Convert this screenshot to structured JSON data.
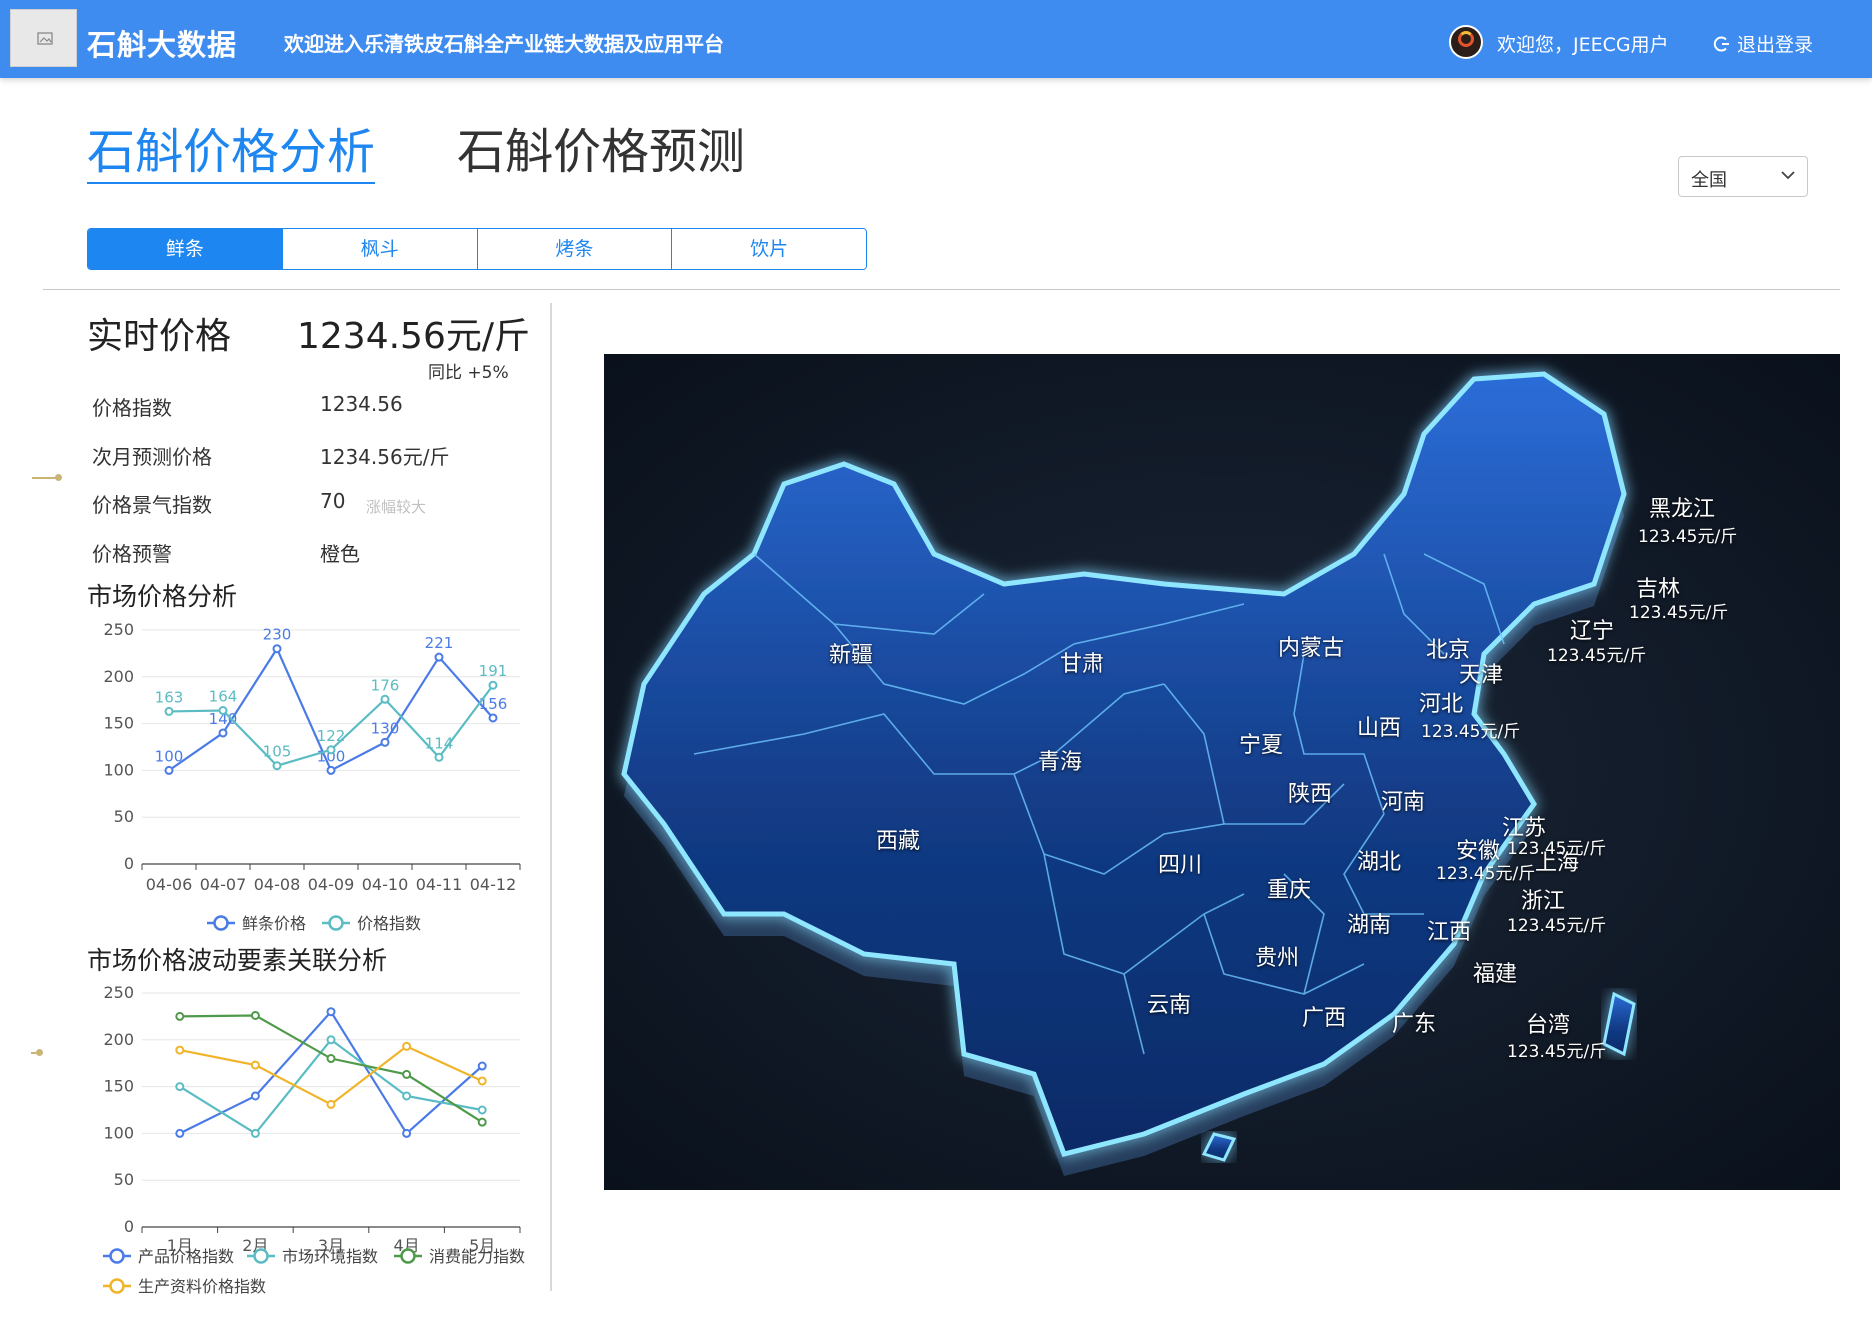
{
  "header": {
    "app_title": "石斛大数据",
    "banner": "欢迎进入乐清铁皮石斛全产业链大数据及应用平台",
    "greeting": "欢迎您，JEECG用户",
    "logout_label": "退出登录",
    "logo_icon": "image-placeholder-icon",
    "avatar_icon": "user-avatar-icon",
    "logout_icon": "logout-icon",
    "accent_color": "#3f8cf0"
  },
  "nav": {
    "tab_analysis": "石斛价格分析",
    "tab_forecast": "石斛价格预测",
    "active": "石斛价格分析"
  },
  "region_select": {
    "value": "全国",
    "icon": "chevron-down-icon"
  },
  "product_tabs": [
    "鲜条",
    "枫斗",
    "烤条",
    "饮片"
  ],
  "realtime": {
    "label": "实时价格",
    "value": "1234.56元/斤",
    "yoy": "同比 +5%"
  },
  "stats": [
    {
      "label": "价格指数",
      "value": "1234.56"
    },
    {
      "label": "次月预测价格",
      "value": "1234.56元/斤"
    },
    {
      "label": "价格景气指数",
      "value": "70",
      "tag": "涨幅较大"
    },
    {
      "label": "价格预警",
      "value": "橙色"
    }
  ],
  "sections": {
    "market": "市场价格分析",
    "factors": "市场价格波动要素关联分析"
  },
  "chart_data": [
    {
      "type": "line",
      "title": "市场价格分析",
      "categories": [
        "04-06",
        "04-07",
        "04-08",
        "04-09",
        "04-10",
        "04-11",
        "04-12"
      ],
      "ylim": [
        0,
        250
      ],
      "yticks": [
        0,
        50,
        100,
        150,
        200,
        250
      ],
      "grid": true,
      "legend": "bottom",
      "series": [
        {
          "name": "鲜条价格",
          "values": [
            100,
            140,
            230,
            100,
            130,
            221,
            156
          ],
          "color": "#4a7be6"
        },
        {
          "name": "价格指数",
          "values": [
            163,
            164,
            105,
            122,
            176,
            114,
            191
          ],
          "color": "#5bbcc4"
        }
      ]
    },
    {
      "type": "line",
      "title": "市场价格波动要素关联分析",
      "categories": [
        "1月",
        "2月",
        "3月",
        "4月",
        "5月"
      ],
      "ylim": [
        0,
        250
      ],
      "yticks": [
        0,
        50,
        100,
        150,
        200,
        250
      ],
      "grid": true,
      "legend": "bottom",
      "series": [
        {
          "name": "产品价格指数",
          "values": [
            100,
            140,
            230,
            100,
            172
          ],
          "color": "#4a7be6"
        },
        {
          "name": "市场环境指数",
          "values": [
            150,
            100,
            200,
            140,
            125
          ],
          "color": "#5bbcc4"
        },
        {
          "name": "消费能力指数",
          "values": [
            225,
            226,
            180,
            163,
            112
          ],
          "color": "#4e9a4a"
        },
        {
          "name": "生产资料价格指数",
          "values": [
            189,
            173,
            131,
            193,
            156
          ],
          "color": "#f0b429"
        }
      ]
    }
  ],
  "map": {
    "provinces": [
      "黑龙江",
      "吉林",
      "辽宁",
      "新疆",
      "甘肃",
      "内蒙古",
      "北京",
      "天津",
      "河北",
      "山西",
      "宁夏",
      "青海",
      "陕西",
      "河南",
      "江苏",
      "上海",
      "安徽",
      "西藏",
      "四川",
      "湖北",
      "重庆",
      "浙江",
      "湖南",
      "江西",
      "贵州",
      "福建",
      "云南",
      "广西",
      "广东",
      "台湾"
    ],
    "price_labels": {
      "黑龙江": "123.45元/斤",
      "吉林": "123.45元/斤",
      "辽宁": "123.45元/斤",
      "河北": "123.45元/斤",
      "江苏": "123.45元/斤",
      "安徽": "123.45元/斤",
      "浙江": "123.45元/斤",
      "台湾": "123.45元/斤"
    }
  }
}
